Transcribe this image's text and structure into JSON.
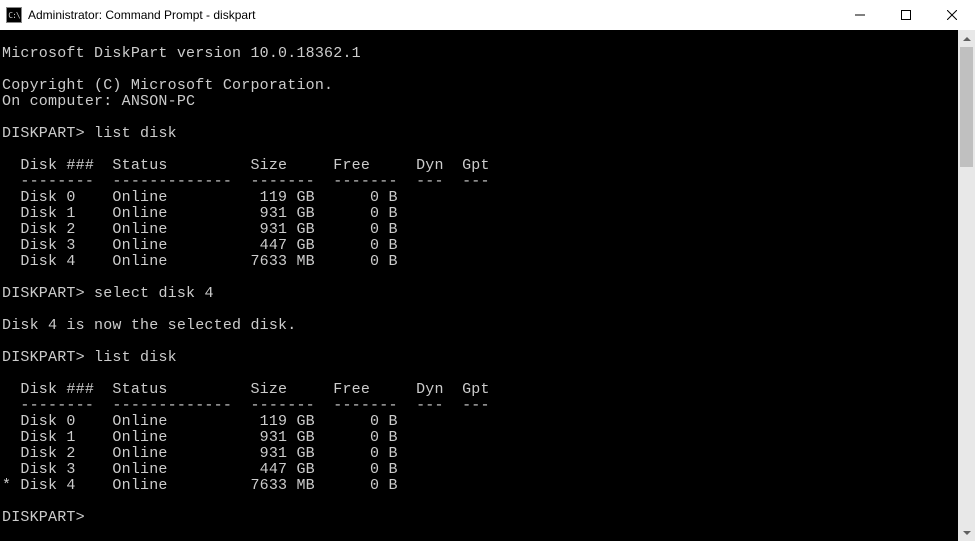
{
  "window": {
    "icon_text": "C:\\",
    "title": "Administrator: Command Prompt - diskpart"
  },
  "terminal": {
    "version_line": "Microsoft DiskPart version 10.0.18362.1",
    "copyright_line": "Copyright (C) Microsoft Corporation.",
    "computer_line": "On computer: ANSON-PC",
    "prompt": "DISKPART>",
    "cmd1": "list disk",
    "table_header": "  Disk ###  Status         Size     Free     Dyn  Gpt",
    "table_divider": "  --------  -------------  -------  -------  ---  ---",
    "disks1": {
      "d0": "  Disk 0    Online          119 GB      0 B",
      "d1": "  Disk 1    Online          931 GB      0 B",
      "d2": "  Disk 2    Online          931 GB      0 B",
      "d3": "  Disk 3    Online          447 GB      0 B",
      "d4": "  Disk 4    Online         7633 MB      0 B"
    },
    "cmd2": "select disk 4",
    "response2": "Disk 4 is now the selected disk.",
    "cmd3": "list disk",
    "disks2": {
      "d0": "  Disk 0    Online          119 GB      0 B",
      "d1": "  Disk 1    Online          931 GB      0 B",
      "d2": "  Disk 2    Online          931 GB      0 B",
      "d3": "  Disk 3    Online          447 GB      0 B",
      "d4": "* Disk 4    Online         7633 MB      0 B"
    }
  }
}
